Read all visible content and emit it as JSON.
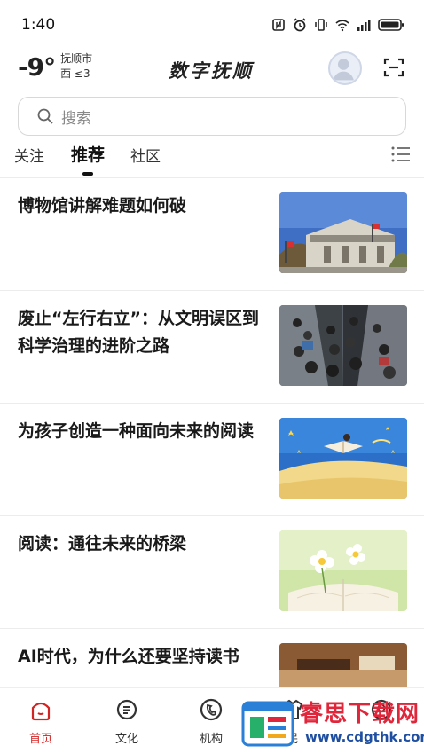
{
  "status_bar": {
    "time": "1:40",
    "icons": [
      "nfc-icon",
      "alarm-icon",
      "vibrate-icon",
      "wifi-icon",
      "signal-icon",
      "battery-icon"
    ]
  },
  "header": {
    "temperature": "-9°",
    "city": "抚顺市",
    "wind": "西 ≤3",
    "brand": "数字抚顺"
  },
  "search": {
    "placeholder": "搜索"
  },
  "tabs": [
    {
      "label": "关注",
      "active": false
    },
    {
      "label": "推荐",
      "active": true
    },
    {
      "label": "社区",
      "active": false
    }
  ],
  "news": [
    {
      "title": "博物馆讲解难题如何破",
      "thumb": "museum-building-image"
    },
    {
      "title": "废止“左行右立”：从文明误区到科学治理的进阶之路",
      "thumb": "escalator-crowd-image"
    },
    {
      "title": "为孩子创造一种面向未来的阅读",
      "thumb": "child-reading-illustration"
    },
    {
      "title": "阅读：通往未来的桥梁",
      "thumb": "open-book-flowers-image"
    },
    {
      "title": "AI时代，为什么还要坚持读书",
      "thumb": "books-desk-image"
    }
  ],
  "bottom_nav": [
    {
      "label": "首页",
      "icon": "home-icon",
      "active": true
    },
    {
      "label": "文化",
      "icon": "culture-icon",
      "active": false
    },
    {
      "label": "机构",
      "icon": "institution-icon",
      "active": false
    },
    {
      "label": "民",
      "icon": "people-icon",
      "active": false
    },
    {
      "label": "",
      "icon": "profile-icon",
      "active": false
    }
  ],
  "watermark": {
    "text": "睿思下载网",
    "url": "www.cdgthk.com"
  },
  "colors": {
    "accent": "#d32424",
    "text": "#1a1a1a",
    "muted": "#888888"
  }
}
